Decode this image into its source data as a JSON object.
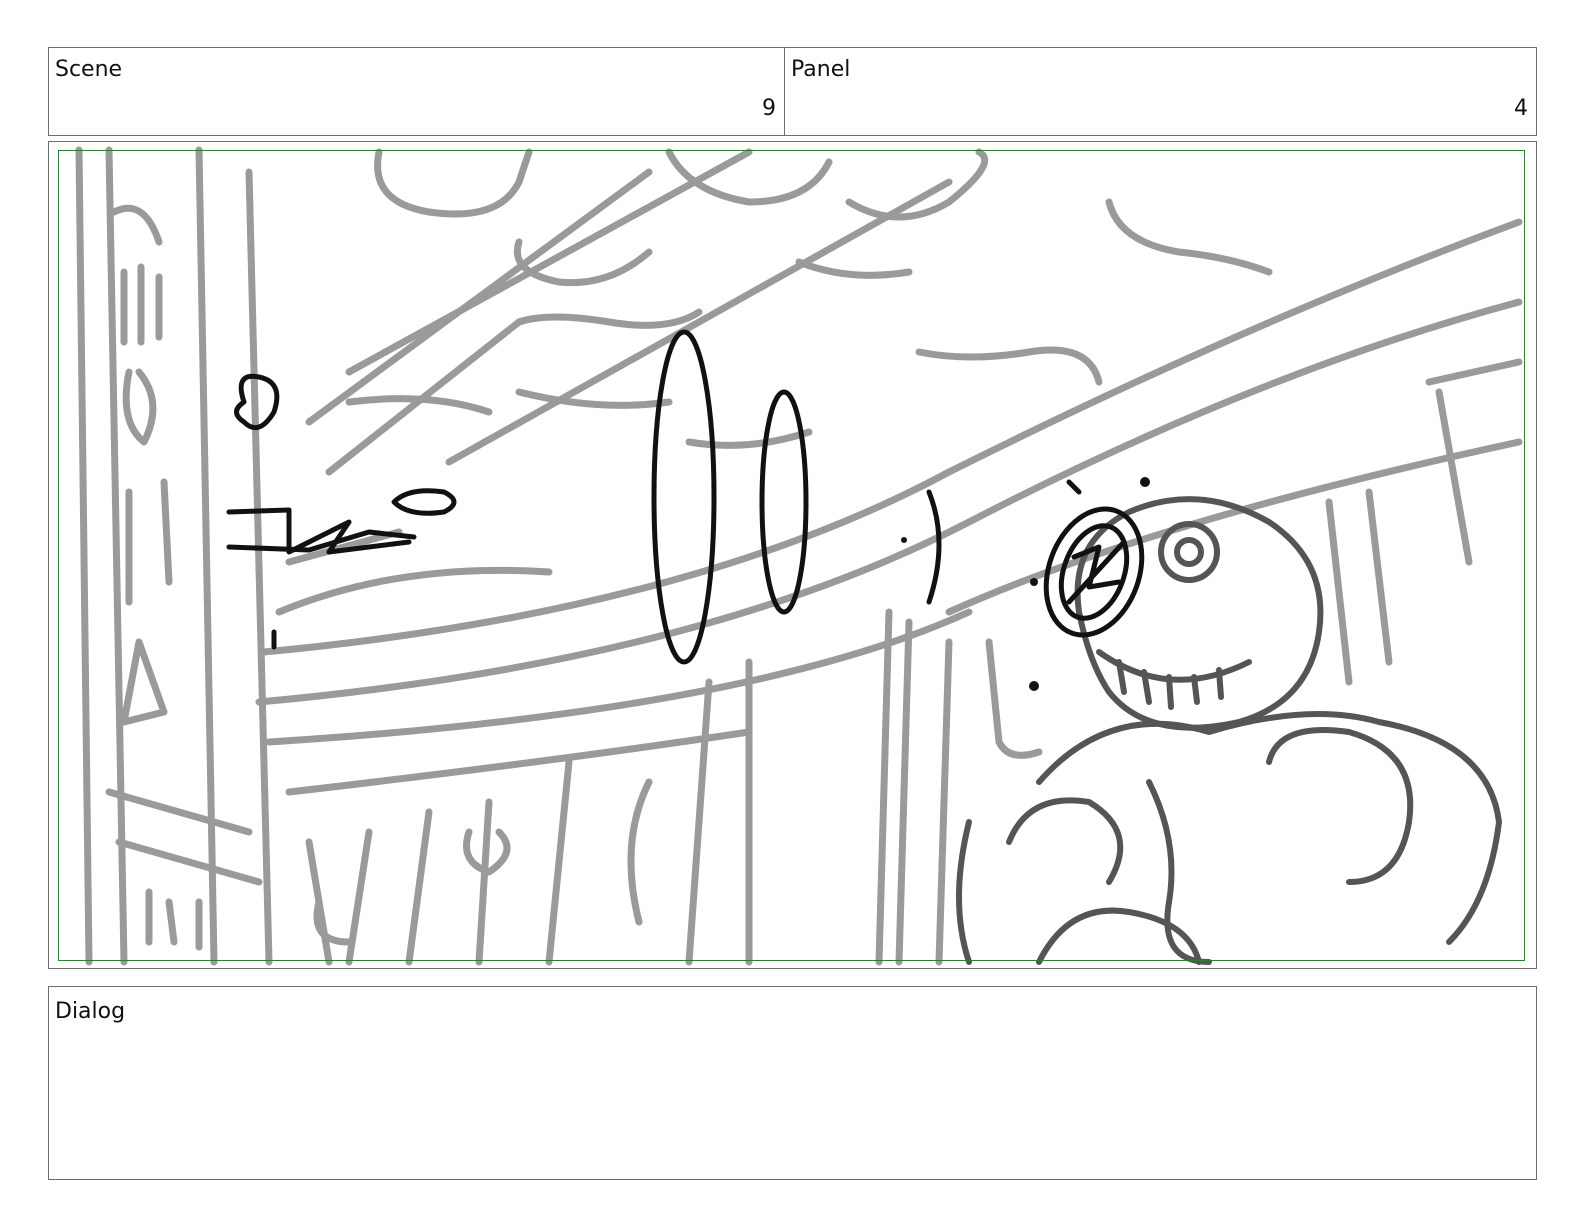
{
  "scene": {
    "label": "Scene",
    "value": "9"
  },
  "panel": {
    "label": "Panel",
    "value": "4"
  },
  "dialog": {
    "label": "Dialog",
    "text": ""
  },
  "colors": {
    "frame_border": "#6e6e6e",
    "safe_area": "#2e7d32",
    "sketch_gray": "#9a9a9a",
    "sketch_black": "#111111"
  }
}
